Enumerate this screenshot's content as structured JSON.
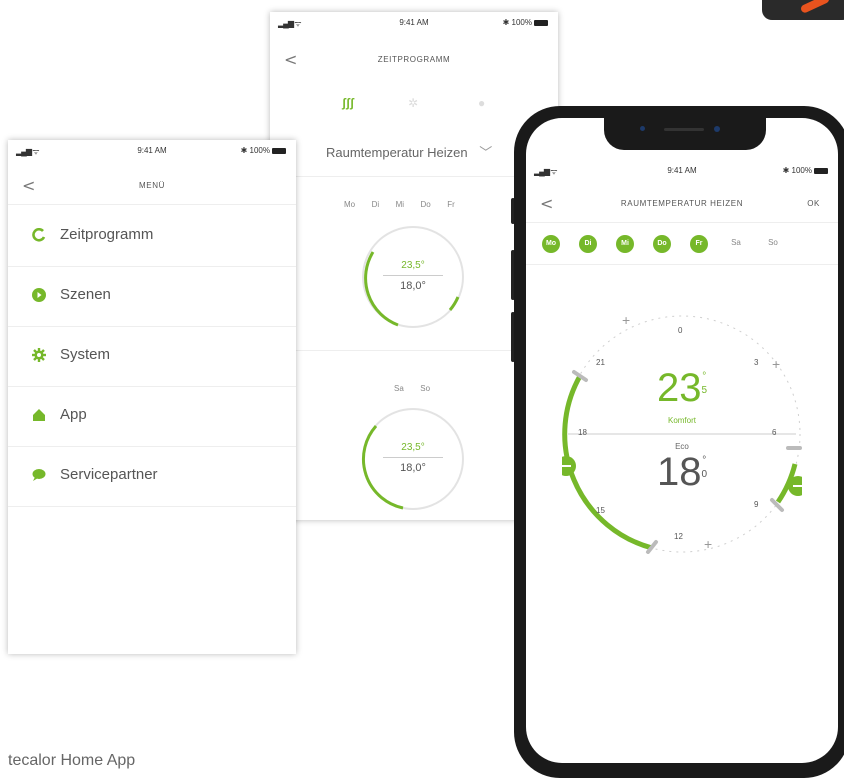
{
  "caption": "tecalor Home App",
  "status": {
    "time": "9:41 AM",
    "battery": "100%"
  },
  "menu_screen": {
    "title": "MENÜ",
    "items": [
      {
        "label": "Zeitprogramm",
        "icon": "refresh-icon"
      },
      {
        "label": "Szenen",
        "icon": "play-circle-icon"
      },
      {
        "label": "System",
        "icon": "gear-icon"
      },
      {
        "label": "App",
        "icon": "house-icon"
      },
      {
        "label": "Servicepartner",
        "icon": "chat-bubble-icon"
      }
    ]
  },
  "schedule_screen": {
    "title": "ZEITPROGRAMM",
    "mode": "Raumtemperatur Heizen",
    "weekdays": [
      "Mo",
      "Di",
      "Mi",
      "Do",
      "Fr"
    ],
    "weekend": [
      "Sa",
      "So"
    ],
    "weekday_comfort": "23,5°",
    "weekday_eco": "18,0°",
    "weekend_comfort": "23,5°",
    "weekend_eco": "18,0°"
  },
  "phone_screen": {
    "title": "RAUMTEMPERATUR HEIZEN",
    "ok": "OK",
    "active_days": [
      "Mo",
      "Di",
      "Mi",
      "Do",
      "Fr"
    ],
    "inactive_days": [
      "Sa",
      "So"
    ],
    "dial_ticks": {
      "top": "0",
      "right": "6",
      "bottom": "12",
      "left": "18",
      "tr": "3",
      "br": "9",
      "bl": "15",
      "tl": "21"
    },
    "comfort_temp": "23",
    "comfort_decimal": "5",
    "comfort_label": "Komfort",
    "eco_label": "Eco",
    "eco_temp": "18",
    "eco_decimal": "0",
    "degree": "°"
  },
  "colors": {
    "accent": "#76b82a",
    "frame": "#1a1a1a",
    "orange": "#e8531e"
  }
}
